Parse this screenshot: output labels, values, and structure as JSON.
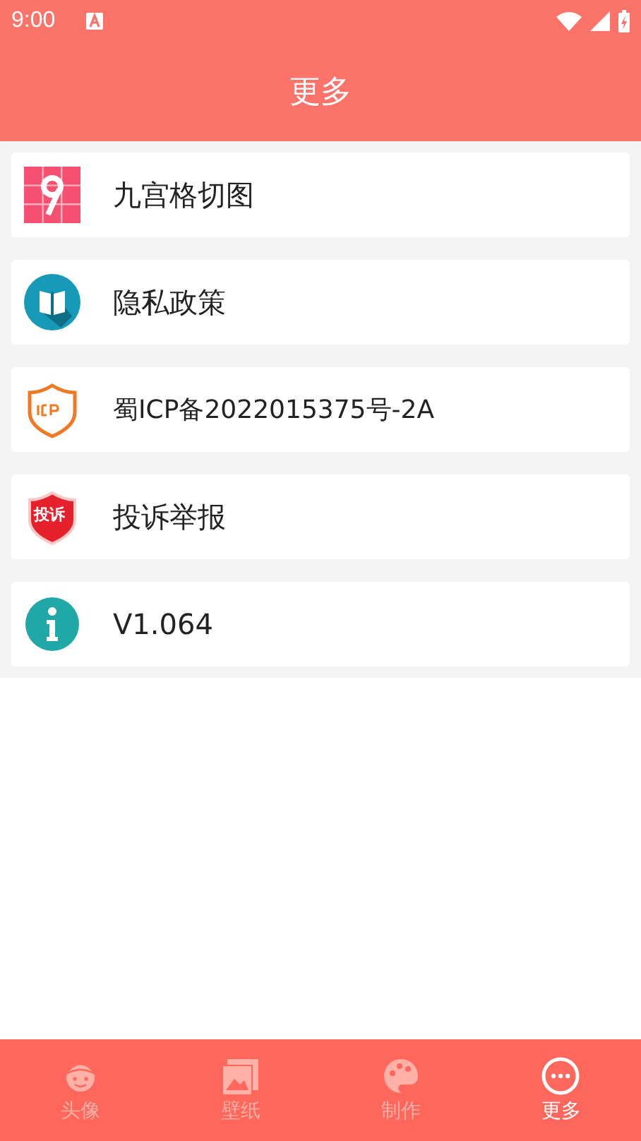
{
  "status_bar": {
    "time": "9:00"
  },
  "header": {
    "title": "更多"
  },
  "items": [
    {
      "kind": "grid",
      "label": "九宫格切图"
    },
    {
      "kind": "book",
      "label": "隐私政策"
    },
    {
      "kind": "icp",
      "label": "蜀ICP备2022015375号-2A"
    },
    {
      "kind": "report",
      "label": "投诉举报",
      "badge": "投诉"
    },
    {
      "kind": "info",
      "label": "V1.064"
    }
  ],
  "tabs": [
    {
      "kind": "avatar",
      "label": "头像",
      "selected": false
    },
    {
      "kind": "wallpaper",
      "label": "壁纸",
      "selected": false
    },
    {
      "kind": "palette",
      "label": "制作",
      "selected": false
    },
    {
      "kind": "more",
      "label": "更多",
      "selected": true
    }
  ]
}
